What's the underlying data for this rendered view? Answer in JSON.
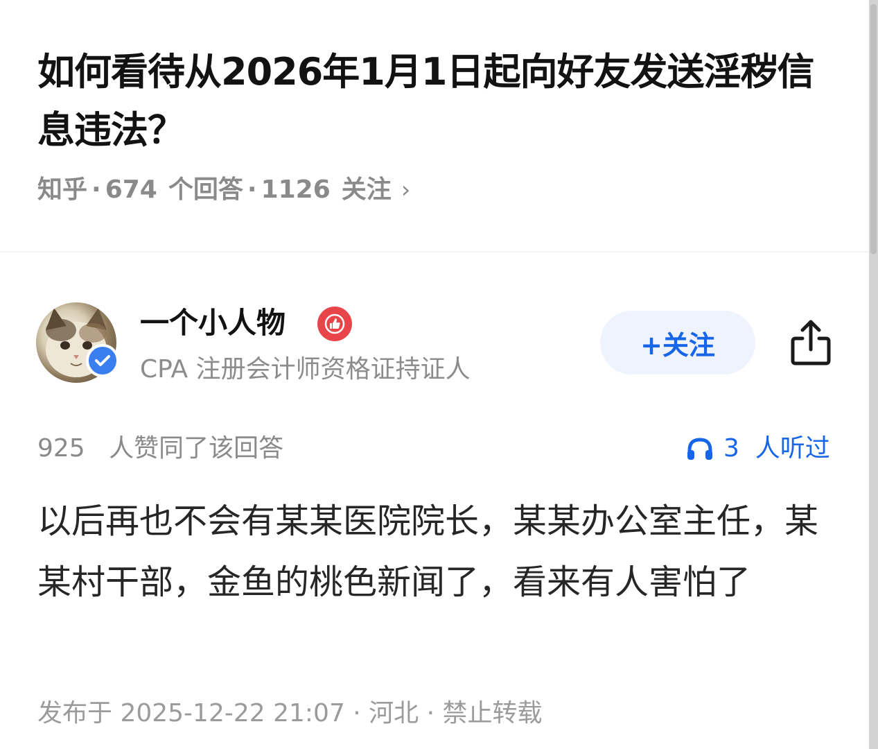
{
  "question": {
    "title": "如何看待从2026年1月1日起向好友发送淫秽信息违法？",
    "source": "知乎",
    "separator": "·",
    "answer_count": "674",
    "answer_unit": "个回答",
    "follow_count": "1126",
    "follow_unit": "关注",
    "chevron": "›"
  },
  "author": {
    "name": "一个小人物",
    "bio": "CPA 注册会计师资格证持证人",
    "avatar_icon": "cat-avatar-icon",
    "verified_icon": "verified-check-icon",
    "badge_icon": "thumbs-up-badge-icon",
    "follow_label": "+关注"
  },
  "stats": {
    "votes_count": "925",
    "votes_text": "人赞同了该回答",
    "listen_count": "3",
    "listen_text": "人听过"
  },
  "answer": {
    "content": "以后再也不会有某某医院院长，某某办公室主任，某某村干部，金鱼的桃色新闻了，看来有人害怕了",
    "footer": "发布于 2025-12-22 21:07 · 河北 · 禁止转载"
  },
  "colors": {
    "accent": "#1765e8",
    "badge_red": "#e8454a",
    "verified_blue": "#3a7ff0",
    "muted_text": "#8a8a8a"
  }
}
